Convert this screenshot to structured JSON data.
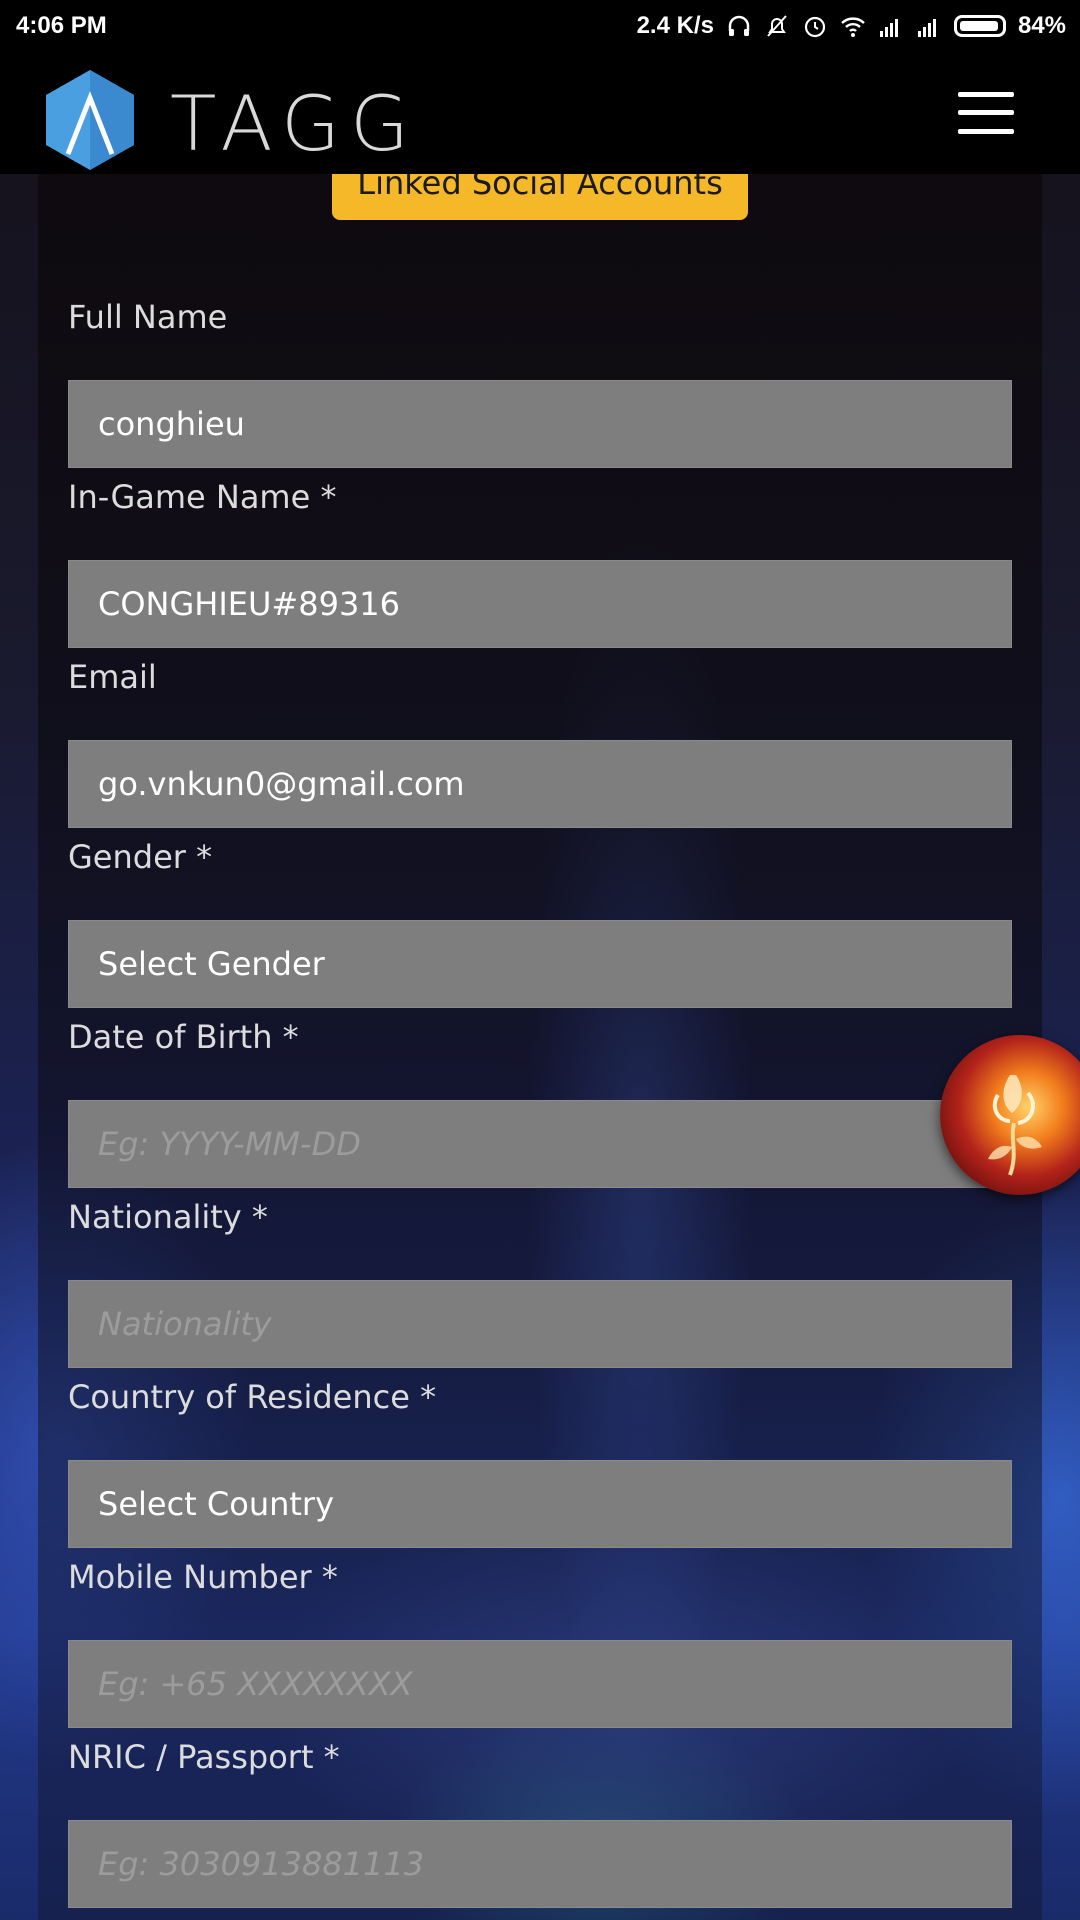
{
  "status_bar": {
    "time": "4:06 PM",
    "net_speed": "2.4 K/s",
    "battery": "84%",
    "icons": [
      "headphones-icon",
      "bell-off-icon",
      "alarm-icon",
      "wifi-icon",
      "signal-icon",
      "signal-icon",
      "battery-icon"
    ]
  },
  "header": {
    "brand": "TAGG",
    "logo_icon": "tagg-hexagon-logo",
    "menu_icon": "hamburger-menu-icon",
    "colors": {
      "logo": "#4a9fe0",
      "background": "#000000"
    }
  },
  "linked_button": {
    "label": "Linked Social Accounts",
    "color": "#f4b828"
  },
  "form": {
    "full_name": {
      "label": "Full Name",
      "value": "conghieu"
    },
    "in_game_name": {
      "label": "In-Game Name *",
      "value": "CONGHIEU#89316"
    },
    "email": {
      "label": "Email",
      "value": "go.vnkun0@gmail.com"
    },
    "gender": {
      "label": "Gender *",
      "selected": "Select Gender"
    },
    "dob": {
      "label": "Date of Birth *",
      "placeholder": "Eg: YYYY-MM-DD"
    },
    "nationality": {
      "label": "Nationality *",
      "placeholder": "Nationality"
    },
    "country": {
      "label": "Country of Residence *",
      "selected": "Select Country"
    },
    "mobile": {
      "label": "Mobile Number *",
      "placeholder": "Eg: +65 XXXXXXXX"
    },
    "nric": {
      "label": "NRIC / Passport *",
      "placeholder": "Eg: 3030913881113"
    }
  },
  "floating_button": {
    "icon": "fire-rose-avatar-icon"
  }
}
